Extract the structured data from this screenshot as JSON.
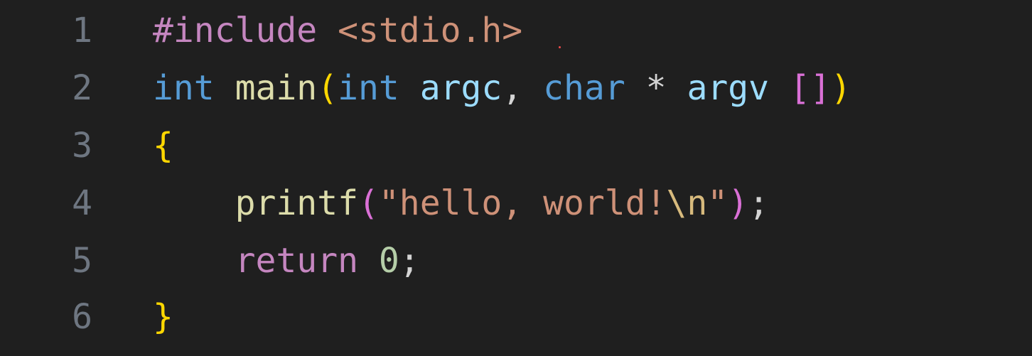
{
  "editor": {
    "background": "#1f1f1f",
    "line_numbers": [
      "1",
      "2",
      "3",
      "4",
      "5",
      "6"
    ],
    "lines": [
      {
        "tokens": [
          {
            "text": "#include",
            "kind": "preprocessor"
          },
          {
            "text": " ",
            "kind": "space"
          },
          {
            "text": "<stdio.h>",
            "kind": "string"
          }
        ]
      },
      {
        "tokens": [
          {
            "text": "int",
            "kind": "type"
          },
          {
            "text": " ",
            "kind": "space"
          },
          {
            "text": "main",
            "kind": "function"
          },
          {
            "text": "(",
            "kind": "paren"
          },
          {
            "text": "int",
            "kind": "type"
          },
          {
            "text": " ",
            "kind": "space"
          },
          {
            "text": "argc",
            "kind": "variable"
          },
          {
            "text": ",",
            "kind": "punctuation"
          },
          {
            "text": " ",
            "kind": "space"
          },
          {
            "text": "char",
            "kind": "type"
          },
          {
            "text": " ",
            "kind": "space"
          },
          {
            "text": "*",
            "kind": "punctuation"
          },
          {
            "text": " ",
            "kind": "space"
          },
          {
            "text": "argv",
            "kind": "variable"
          },
          {
            "text": " ",
            "kind": "space"
          },
          {
            "text": "[]",
            "kind": "bracket"
          },
          {
            "text": ")",
            "kind": "paren"
          }
        ]
      },
      {
        "tokens": [
          {
            "text": "{",
            "kind": "brace"
          }
        ]
      },
      {
        "tokens": [
          {
            "text": "    ",
            "kind": "indent"
          },
          {
            "text": "printf",
            "kind": "function"
          },
          {
            "text": "(",
            "kind": "paren"
          },
          {
            "text": "\"hello, world!",
            "kind": "string"
          },
          {
            "text": "\\n",
            "kind": "escape"
          },
          {
            "text": "\"",
            "kind": "string"
          },
          {
            "text": ")",
            "kind": "paren"
          },
          {
            "text": ";",
            "kind": "punctuation"
          }
        ]
      },
      {
        "tokens": [
          {
            "text": "    ",
            "kind": "indent"
          },
          {
            "text": "return",
            "kind": "keyword"
          },
          {
            "text": " ",
            "kind": "space"
          },
          {
            "text": "0",
            "kind": "number"
          },
          {
            "text": ";",
            "kind": "punctuation"
          }
        ]
      },
      {
        "tokens": [
          {
            "text": "}",
            "kind": "brace"
          }
        ]
      }
    ],
    "colors": {
      "line_number": "#6e7681",
      "preprocessor": "#c586c0",
      "string": "#ce9178",
      "type": "#569cd6",
      "function": "#dcdcaa",
      "paren_yellow": "#ffd700",
      "paren_pink": "#da70d6",
      "variable": "#9cdcfe",
      "punctuation": "#d4d4d4",
      "keyword": "#c586c0",
      "number": "#b5cea8",
      "error_marker": "#f14c4c"
    }
  }
}
